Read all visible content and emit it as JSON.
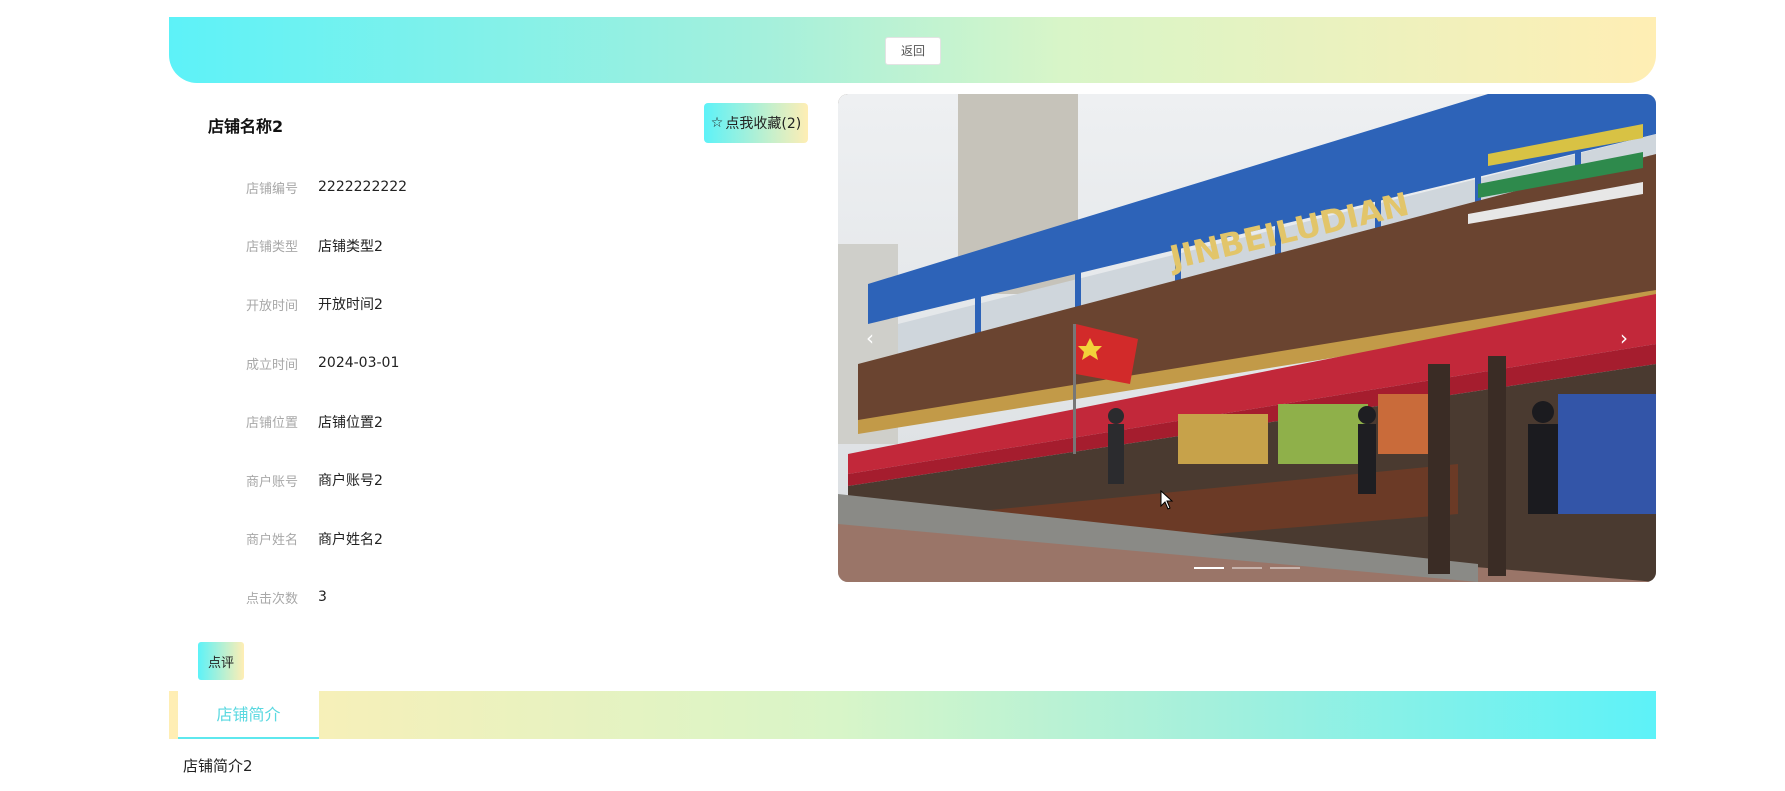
{
  "header": {
    "back_label": "返回"
  },
  "shop": {
    "title": "店铺名称2",
    "favorite_label": "点我收藏(2)",
    "favorite_icon": "star-outline-icon"
  },
  "info": [
    {
      "label": "店铺编号",
      "value": "2222222222"
    },
    {
      "label": "店铺类型",
      "value": "店铺类型2"
    },
    {
      "label": "开放时间",
      "value": "开放时间2"
    },
    {
      "label": "成立时间",
      "value": "2024-03-01"
    },
    {
      "label": "店铺位置",
      "value": "店铺位置2"
    },
    {
      "label": "商户账号",
      "value": "商户账号2"
    },
    {
      "label": "商户姓名",
      "value": "商户姓名2"
    },
    {
      "label": "点击次数",
      "value": "3"
    }
  ],
  "review_label": "点评",
  "carousel": {
    "image_text": "JINBEILUDIAN",
    "prev_icon": "chevron-left-icon",
    "next_icon": "chevron-right-icon",
    "slide_count": 3,
    "active_index": 0
  },
  "tabs": [
    {
      "label": "店铺简介",
      "active": true
    }
  ],
  "intro": {
    "text": "店铺简介2"
  },
  "colors": {
    "accent_cyan": "#5df2f8",
    "accent_yellow": "#ffeeb4",
    "tab_text": "#5ad8e0"
  }
}
